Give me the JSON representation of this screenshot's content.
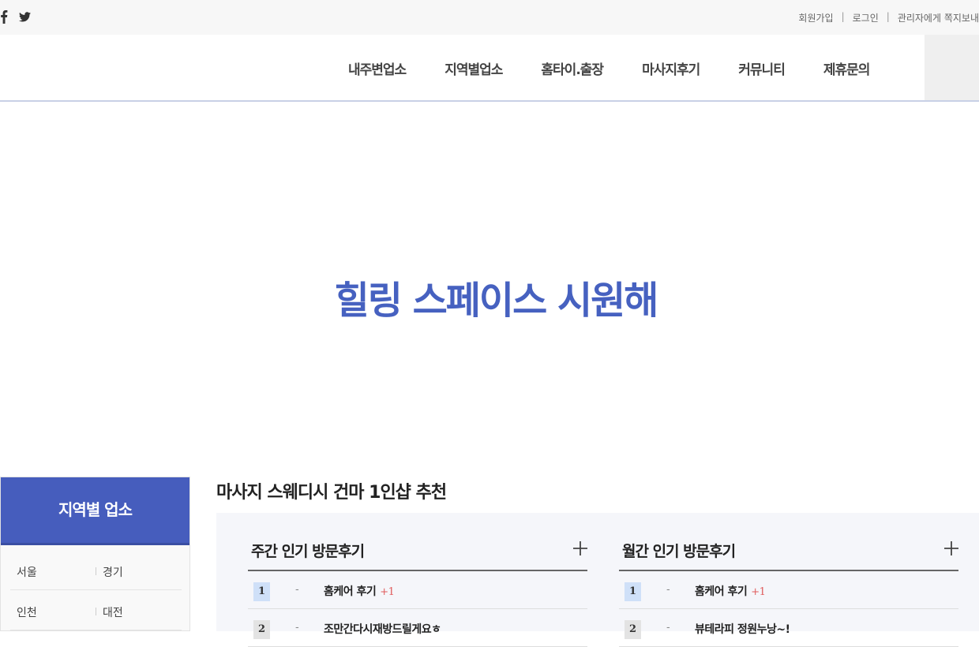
{
  "top": {
    "links": [
      "회원가입",
      "로그인",
      "관리자에게 쪽지보내"
    ],
    "separator": "|"
  },
  "nav": {
    "items": [
      "내주변업소",
      "지역별업소",
      "홈타이.출장",
      "마사지후기",
      "커뮤니티",
      "제휴문의"
    ]
  },
  "hero": {
    "title": "힐링 스페이스 시원해",
    "color": "#4661c0"
  },
  "sidebar": {
    "title": "지역별 업소",
    "rows": [
      [
        "서울",
        "경기"
      ],
      [
        "인천",
        "대전"
      ]
    ]
  },
  "main": {
    "title": "마사지 스웨디시 건마 1인샵 추천",
    "weekly": {
      "title": "주간 인기 방문후기",
      "rows": [
        {
          "rank": "1",
          "change": "-",
          "text": "홈케어 후기",
          "count": "+1"
        },
        {
          "rank": "2",
          "change": "-",
          "text": "조만간다시재방드릴게요ㅎ",
          "count": ""
        }
      ]
    },
    "monthly": {
      "title": "월간 인기 방문후기",
      "rows": [
        {
          "rank": "1",
          "change": "-",
          "text": "홈케어 후기",
          "count": "+1"
        },
        {
          "rank": "2",
          "change": "-",
          "text": "뷰테라피 정원누낭~!",
          "count": ""
        }
      ]
    }
  }
}
